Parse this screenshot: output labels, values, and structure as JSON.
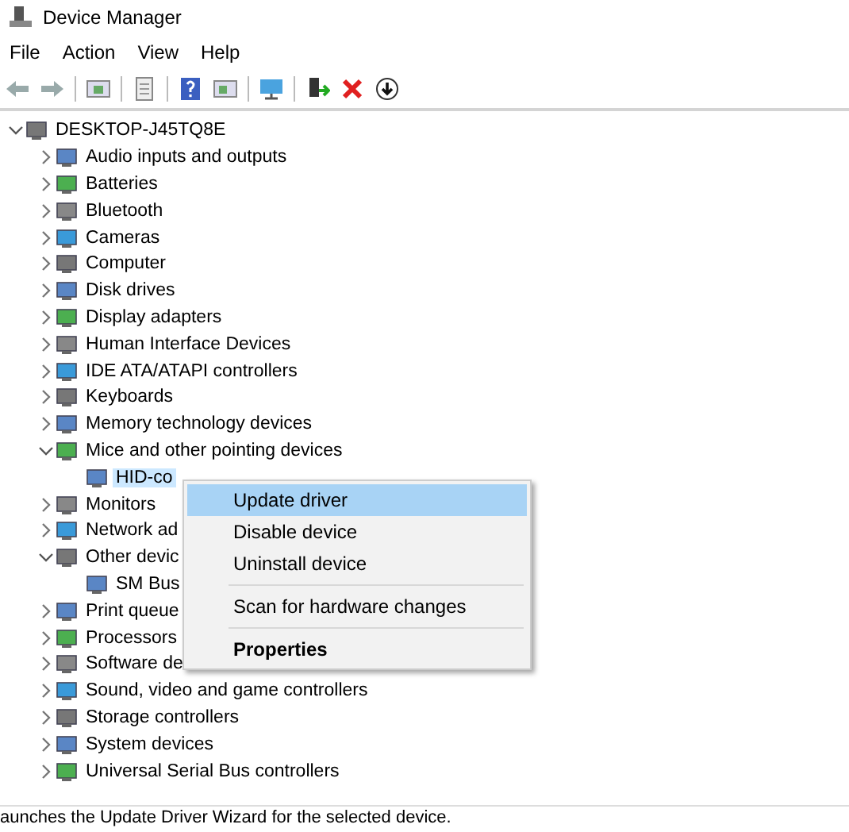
{
  "window": {
    "title": "Device Manager"
  },
  "menu_bar": [
    "File",
    "Action",
    "View",
    "Help"
  ],
  "tree": {
    "label": "DESKTOP-J45TQ8E",
    "expanded": true,
    "children": [
      {
        "label": "Audio inputs and outputs",
        "expanded": false
      },
      {
        "label": "Batteries",
        "expanded": false
      },
      {
        "label": "Bluetooth",
        "expanded": false
      },
      {
        "label": "Cameras",
        "expanded": false
      },
      {
        "label": "Computer",
        "expanded": false
      },
      {
        "label": "Disk drives",
        "expanded": false
      },
      {
        "label": "Display adapters",
        "expanded": false
      },
      {
        "label": "Human Interface Devices",
        "expanded": false
      },
      {
        "label": "IDE ATA/ATAPI controllers",
        "expanded": false
      },
      {
        "label": "Keyboards",
        "expanded": false
      },
      {
        "label": "Memory technology devices",
        "expanded": false
      },
      {
        "label": "Mice and other pointing devices",
        "expanded": true,
        "children": [
          {
            "label": "HID-co",
            "selected": true
          }
        ]
      },
      {
        "label": "Monitors",
        "expanded": false
      },
      {
        "label": "Network ad",
        "expanded": false
      },
      {
        "label": "Other devic",
        "expanded": true,
        "children": [
          {
            "label": "SM Bus",
            "selected": false
          }
        ]
      },
      {
        "label": "Print queue",
        "expanded": false
      },
      {
        "label": "Processors",
        "expanded": false
      },
      {
        "label": "Software de",
        "expanded": false
      },
      {
        "label": "Sound, video and game controllers",
        "expanded": false
      },
      {
        "label": "Storage controllers",
        "expanded": false
      },
      {
        "label": "System devices",
        "expanded": false
      },
      {
        "label": "Universal Serial Bus controllers",
        "expanded": false
      }
    ]
  },
  "context_menu": [
    {
      "label": "Update driver",
      "selected": true,
      "separator_before": false,
      "default": false
    },
    {
      "label": "Disable device",
      "selected": false,
      "separator_before": false,
      "default": false
    },
    {
      "label": "Uninstall device",
      "selected": false,
      "separator_before": false,
      "default": false
    },
    {
      "label": "Scan for hardware changes",
      "selected": false,
      "separator_before": true,
      "default": false
    },
    {
      "label": "Properties",
      "selected": false,
      "separator_before": true,
      "default": true
    }
  ],
  "status_bar": "aunches the Update Driver Wizard for the selected device."
}
